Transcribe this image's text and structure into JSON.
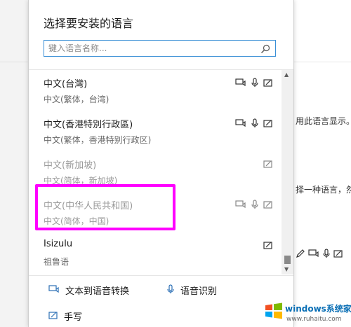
{
  "dialog": {
    "title": "选择要安装的语言",
    "search_placeholder": "键入语言名称..."
  },
  "languages": [
    {
      "name": "中文(台灣)",
      "sub": "中文(繁体，台湾)",
      "features": [
        "text-to-speech",
        "speech",
        "handwriting"
      ],
      "dimmed": false
    },
    {
      "name": "中文(香港特別行政區)",
      "sub": "中文(繁体，香港特别行政区)",
      "features": [
        "text-to-speech",
        "speech",
        "handwriting"
      ],
      "dimmed": false
    },
    {
      "name": "中文(新加坡)",
      "sub": "中文(简体，新加坡)",
      "features": [
        "handwriting"
      ],
      "dimmed": true
    },
    {
      "name": "中文(中华人民共和国)",
      "sub": "中文(简体，中国)",
      "features": [
        "text-to-speech",
        "speech",
        "handwriting"
      ],
      "dimmed": true
    },
    {
      "name": "Isizulu",
      "sub": "祖鲁语",
      "features": [
        "handwriting"
      ],
      "dimmed": false
    }
  ],
  "legend": {
    "tts": "文本到语音转换",
    "speech": "语音识别",
    "handwriting": "手写"
  },
  "background": {
    "line1": "用此语言显示。",
    "line2": "择一种语言，然"
  },
  "watermark": {
    "title": "windows系统家园",
    "url": "www.ruhaitu.com"
  },
  "colors": {
    "accent": "#3a8fd6",
    "highlight": "#ff00ff"
  }
}
